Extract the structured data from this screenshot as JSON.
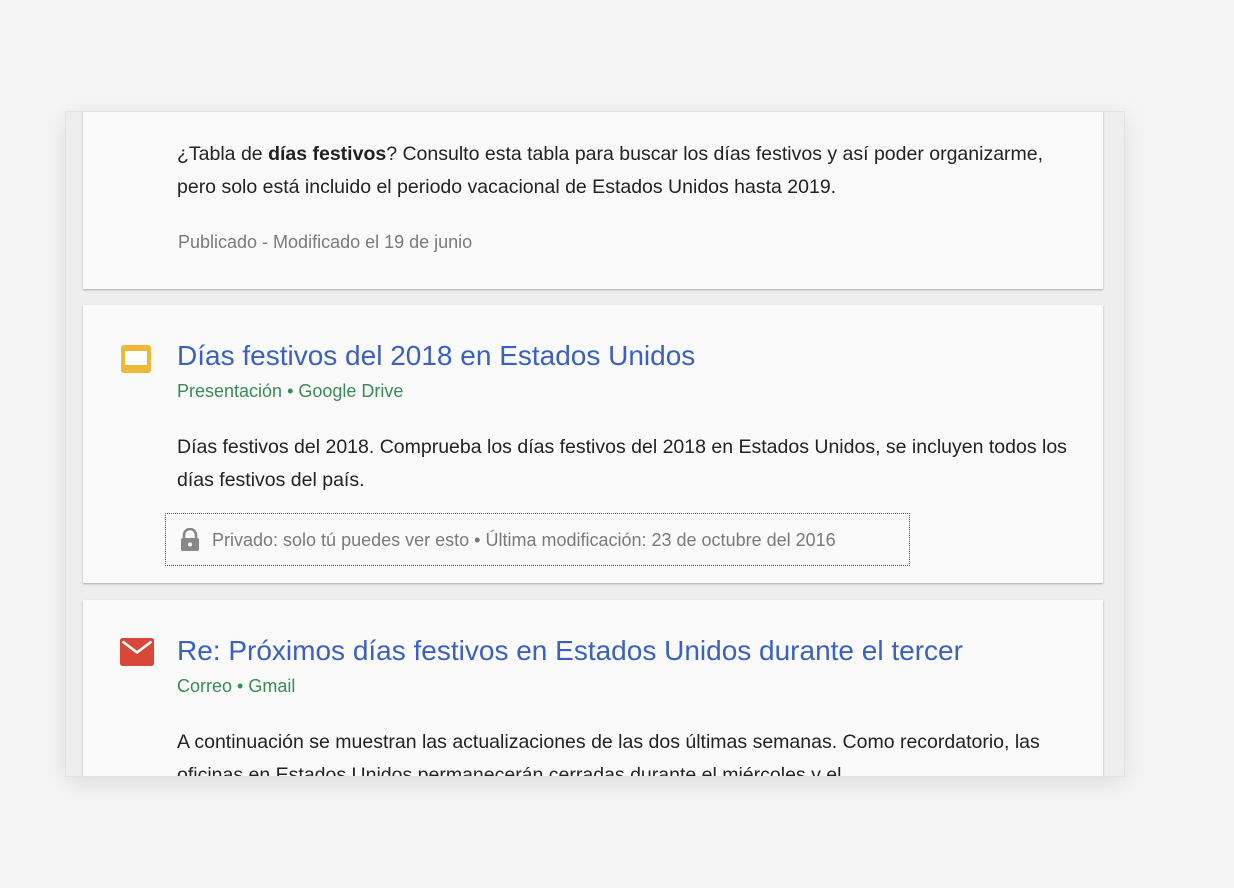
{
  "results": [
    {
      "snippet_pre": "¿Tabla de ",
      "snippet_bold": "días festivos",
      "snippet_post": "? Consulto esta tabla para buscar los días festivos y así poder organizarme, pero solo está incluido el periodo vacacional de Estados Unidos hasta 2019.",
      "status": "Publicado - Modificado el 19 de junio"
    },
    {
      "icon": "slides-icon",
      "icon_color": "#f0b839",
      "title": "Días festivos del 2018 en Estados Unidos",
      "meta": "Presentación • Google Drive",
      "snippet": "Días festivos del 2018. Comprueba los días festivos del 2018 en Estados Unidos, se incluyen todos los días festivos del país.",
      "privacy_icon": "lock-icon",
      "privacy_text": "Privado: solo tú puedes ver esto • Última modificación: 23 de octubre del 2016"
    },
    {
      "icon": "mail-icon",
      "icon_color": "#d9463a",
      "title": "Re: Próximos días festivos en Estados Unidos durante el tercer",
      "meta": "Correo • Gmail",
      "snippet": "A continuación se muestran las actualizaciones de las dos últimas semanas. Como recordatorio, las oficinas en Estados Unidos permanecerán cerradas durante el miércoles y el"
    }
  ],
  "colors": {
    "title": "#3c5fc2",
    "meta": "#3a8a55",
    "body_text": "#222222",
    "secondary_text": "#7a7a7a",
    "highlight_border": "#c62828"
  }
}
